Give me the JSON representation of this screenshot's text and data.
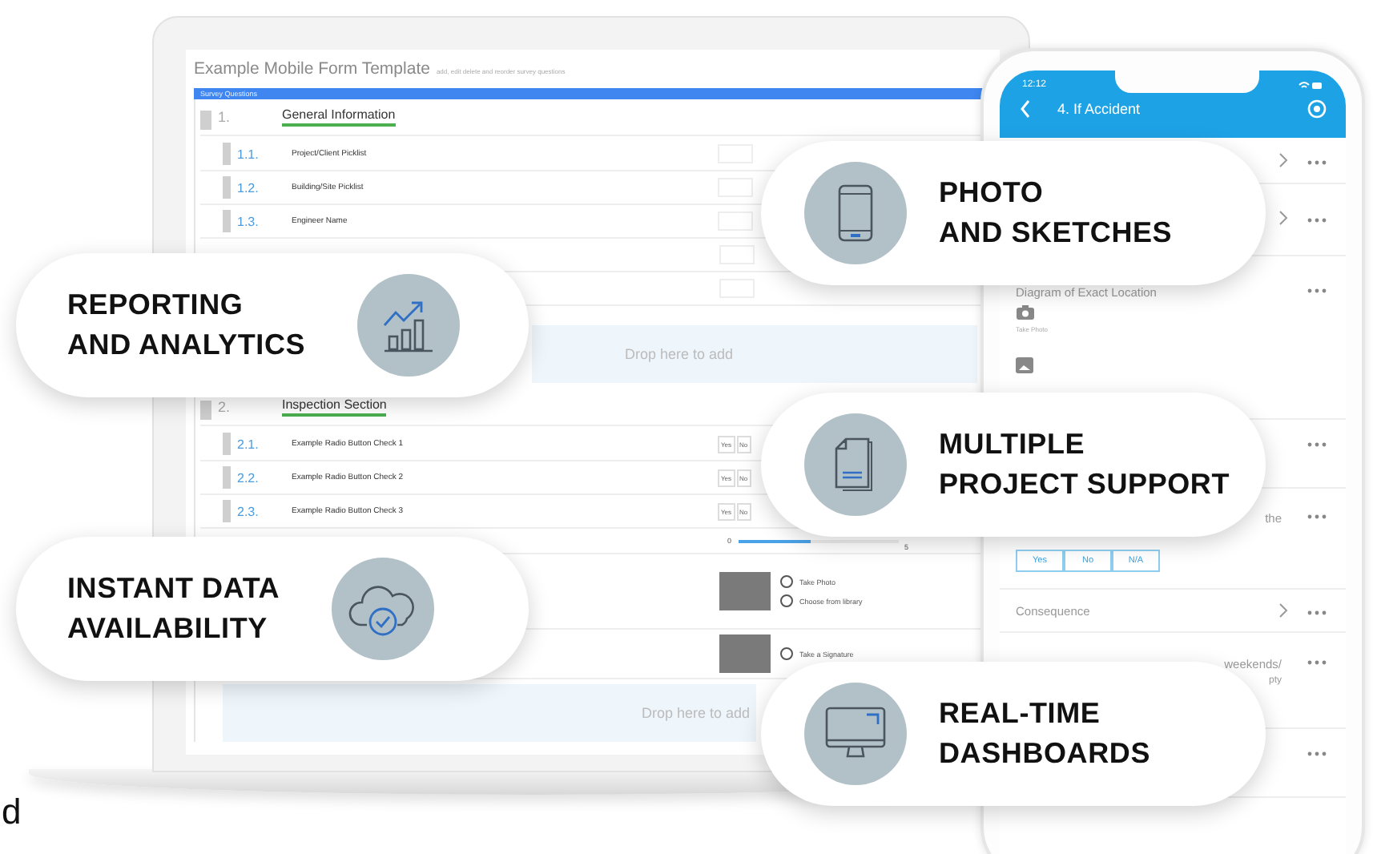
{
  "laptop": {
    "title": "Example Mobile Form Template",
    "subtitle": "add, edit delete and reorder survey questions",
    "panel_title": "Survey Questions",
    "sections": [
      {
        "number": "1.",
        "title": "General Information",
        "rows": [
          {
            "kind": "field",
            "number": "1.1.",
            "label": "Project/Client Picklist"
          },
          {
            "kind": "field",
            "number": "1.2.",
            "label": "Building/Site Picklist"
          },
          {
            "kind": "field",
            "number": "1.3.",
            "label": "Engineer Name"
          },
          {
            "kind": "blank"
          },
          {
            "kind": "blank"
          }
        ],
        "drop": "Drop here to add"
      },
      {
        "number": "2.",
        "title": "Inspection Section",
        "rows": [
          {
            "kind": "radio",
            "number": "2.1.",
            "label": "Example Radio Button Check 1",
            "options": [
              "Yes",
              "No"
            ]
          },
          {
            "kind": "radio",
            "number": "2.2.",
            "label": "Example Radio Button Check 2",
            "options": [
              "Yes",
              "No"
            ]
          },
          {
            "kind": "radio",
            "number": "2.3.",
            "label": "Example Radio Button Check 3",
            "options": [
              "Yes",
              "No"
            ]
          },
          {
            "kind": "slider",
            "min": "0",
            "max": "5",
            "level": 0.45
          },
          {
            "kind": "photo",
            "actions": [
              "Take Photo",
              "Choose from library"
            ]
          },
          {
            "kind": "signature",
            "actions": [
              "Take a Signature"
            ]
          }
        ],
        "drop": "Drop here to add"
      }
    ]
  },
  "phone": {
    "time": "12:12",
    "title": "4. If Accident",
    "rows": [
      {
        "kind": "nav"
      },
      {
        "kind": "nav"
      },
      {
        "kind": "photo",
        "label": "Diagram of Exact Location",
        "action": "Take Photo"
      },
      {
        "kind": "menu"
      },
      {
        "kind": "choice",
        "label": "the",
        "options": [
          "Yes",
          "No",
          "N/A"
        ]
      },
      {
        "kind": "navlabel",
        "label": "Consequence"
      },
      {
        "kind": "text",
        "label": "weekends/",
        "note": "pty"
      },
      {
        "kind": "menu"
      }
    ]
  },
  "features": [
    {
      "kind": "chart",
      "label_lines": [
        "REPORTING",
        "AND ANALYTICS"
      ]
    },
    {
      "kind": "phone",
      "label_lines": [
        "PHOTO",
        "AND SKETCHES"
      ]
    },
    {
      "kind": "document",
      "label_lines": [
        "MULTIPLE",
        "PROJECT SUPPORT"
      ]
    },
    {
      "kind": "cloud",
      "label_lines": [
        "INSTANT DATA",
        "AVAILABILITY"
      ]
    },
    {
      "kind": "monitor",
      "label_lines": [
        "REAL-TIME",
        "DASHBOARDS"
      ]
    }
  ],
  "edge_text": "d"
}
